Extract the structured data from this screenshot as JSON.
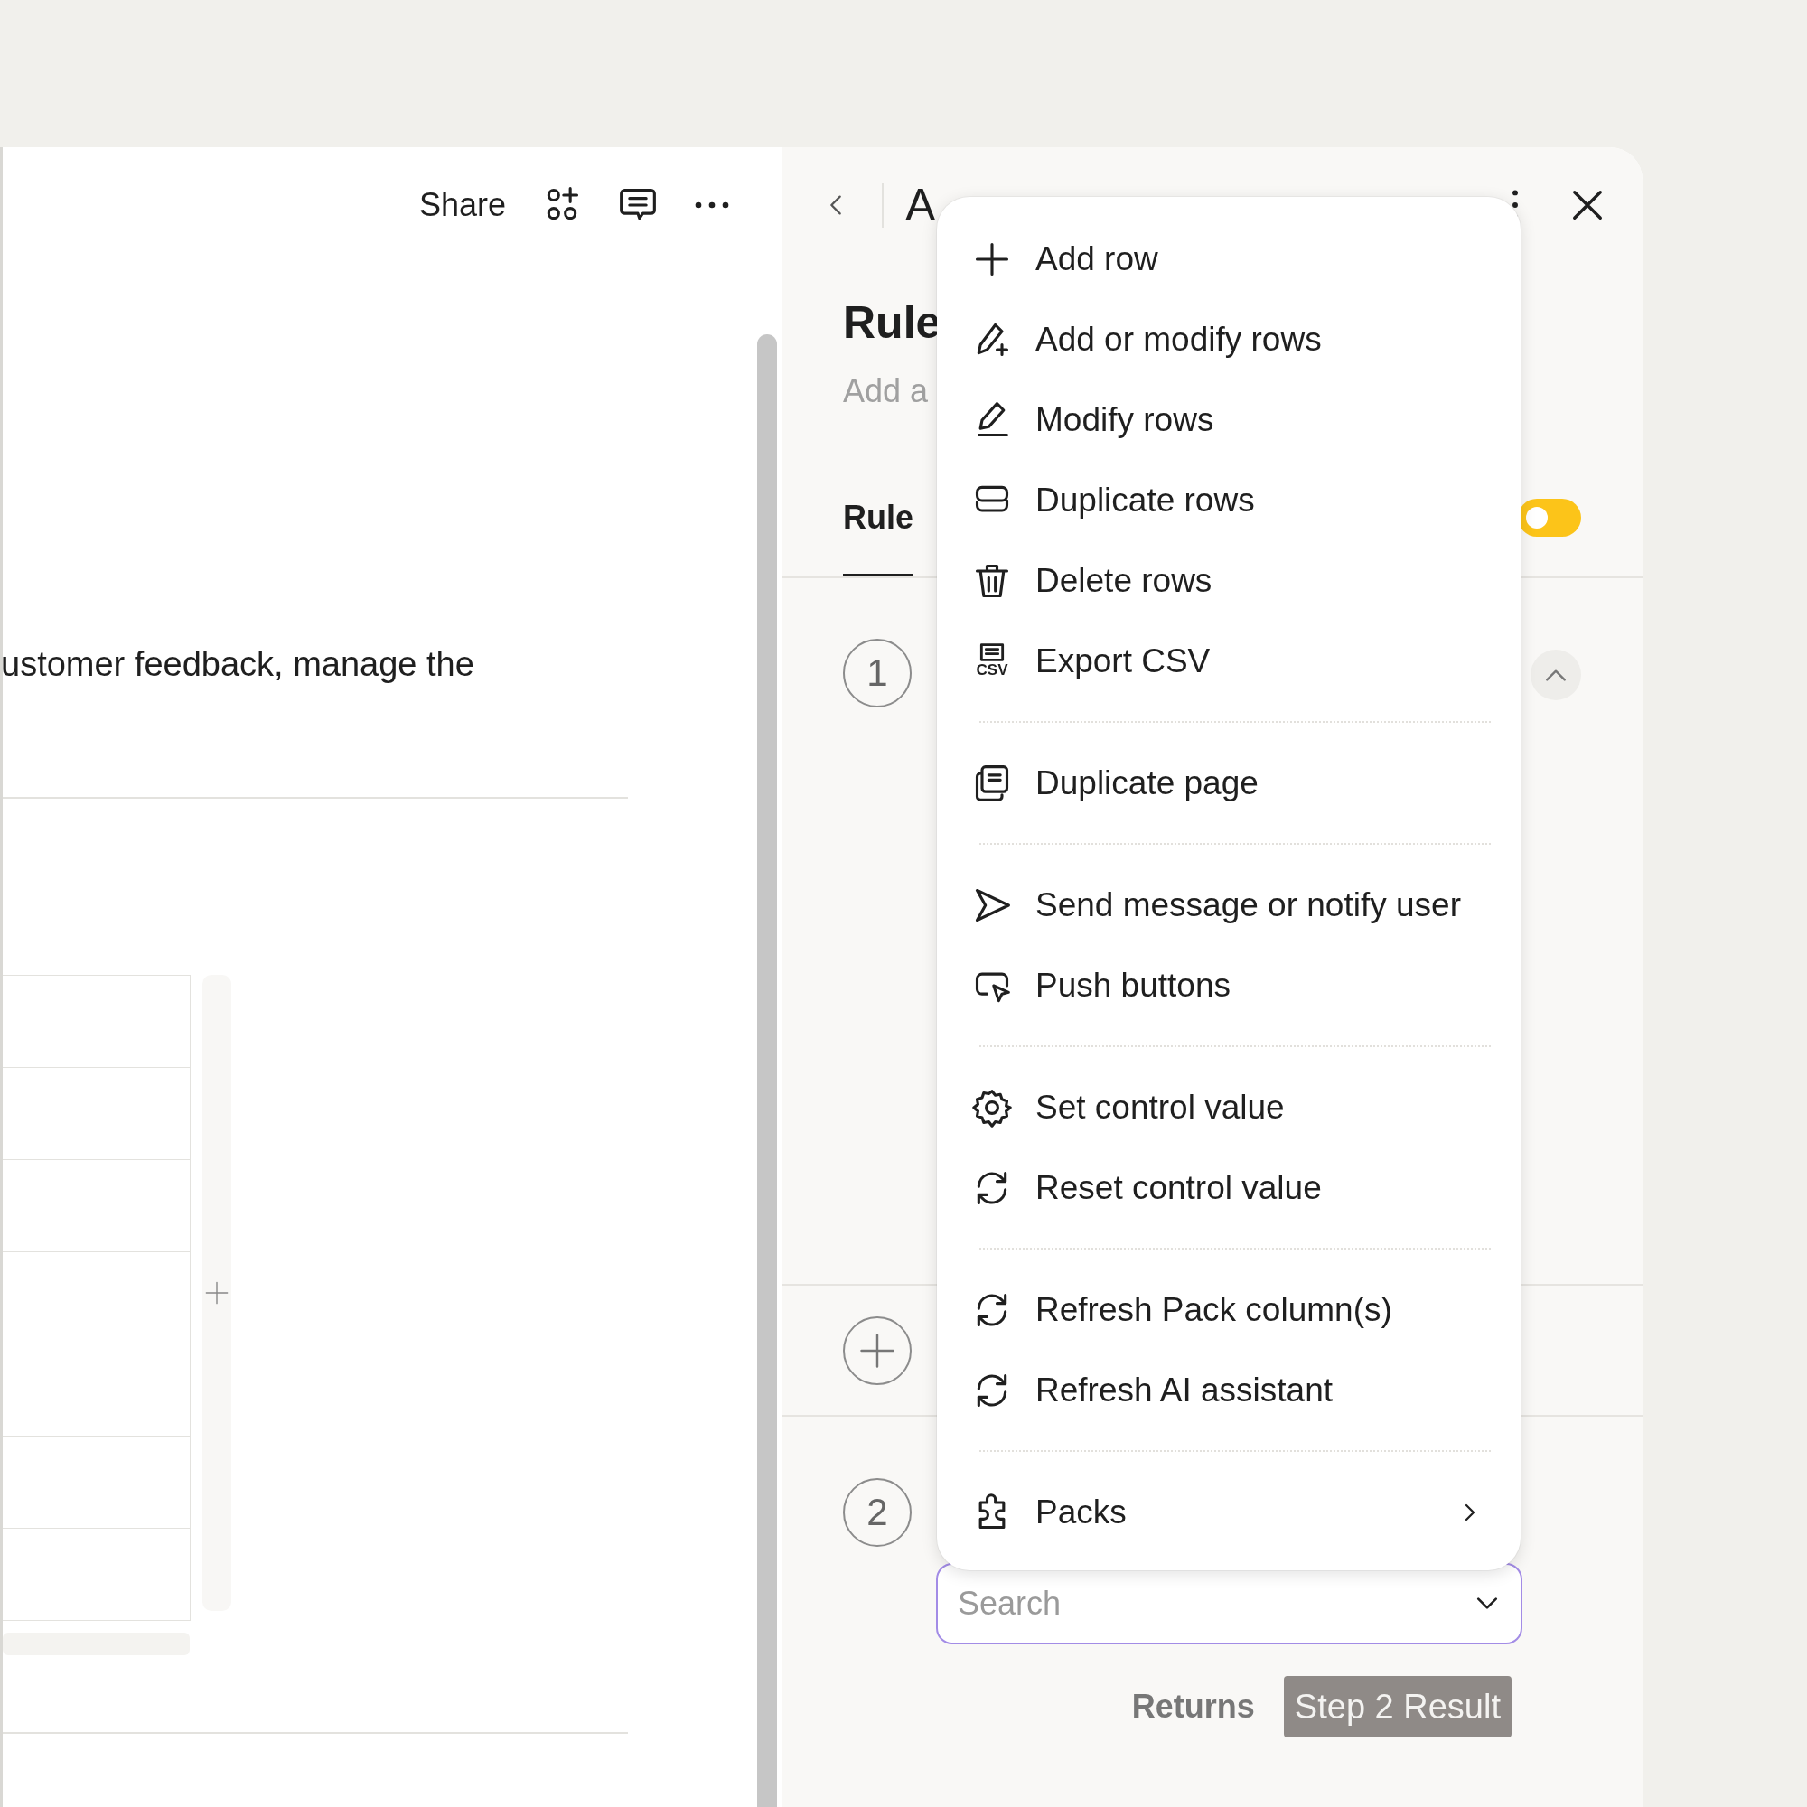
{
  "document": {
    "share_label": "Share",
    "body_text": "ustomer feedback, manage the"
  },
  "panel": {
    "title": "A",
    "rule_title": "Rule",
    "description_placeholder": "Add a",
    "tabs": [
      {
        "label": "Rule",
        "selected": true
      }
    ],
    "toggle": {
      "on": true
    },
    "steps": [
      {
        "number": "1",
        "expanded": true
      },
      {
        "number": "2"
      }
    ],
    "search": {
      "placeholder": "Search"
    },
    "returns_label": "Returns",
    "result_chip": "Step 2 Result"
  },
  "menu": {
    "groups": [
      {
        "items": [
          {
            "label": "Add row",
            "submenu": false
          },
          {
            "label": "Add or modify rows",
            "submenu": false
          },
          {
            "label": "Modify rows",
            "submenu": false
          },
          {
            "label": "Duplicate rows",
            "submenu": false
          },
          {
            "label": "Delete rows",
            "submenu": false
          },
          {
            "label": "Export CSV",
            "icon_text": "CSV",
            "submenu": false
          }
        ]
      },
      {
        "items": [
          {
            "label": "Duplicate page",
            "submenu": false
          }
        ]
      },
      {
        "items": [
          {
            "label": "Send message or notify user",
            "submenu": false
          },
          {
            "label": "Push buttons",
            "submenu": false
          }
        ]
      },
      {
        "items": [
          {
            "label": "Set control value",
            "submenu": false
          },
          {
            "label": "Reset control value",
            "submenu": false
          }
        ]
      },
      {
        "items": [
          {
            "label": "Refresh Pack column(s)",
            "submenu": false
          },
          {
            "label": "Refresh AI assistant",
            "submenu": false
          }
        ]
      },
      {
        "items": [
          {
            "label": "Packs",
            "submenu": true
          }
        ]
      }
    ]
  }
}
